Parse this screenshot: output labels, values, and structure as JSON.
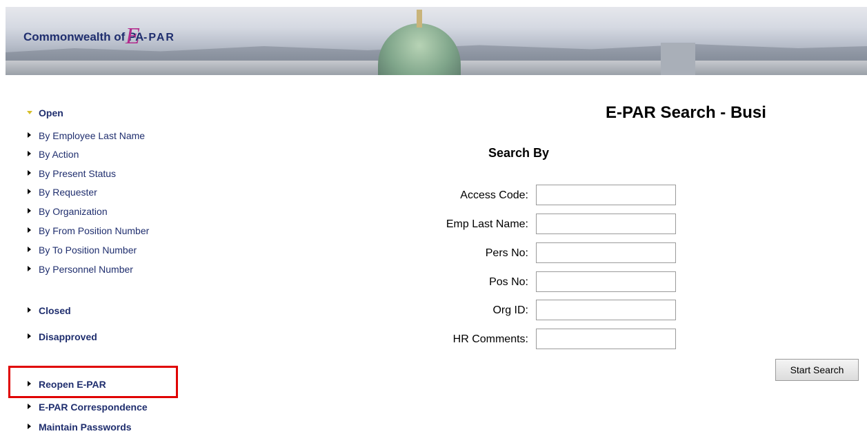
{
  "header": {
    "logo_text": "Commonwealth of PA",
    "logo_e": "E",
    "logo_suffix": "-PAR"
  },
  "sidebar": {
    "open_label": "Open",
    "sub_items": [
      "By Employee Last Name",
      "By Action",
      "By Present Status",
      "By Requester",
      "By Organization",
      "By From Position Number",
      "By To Position Number",
      "By Personnel Number"
    ],
    "closed_label": "Closed",
    "disapproved_label": "Disapproved",
    "reopen_label": "Reopen E-PAR",
    "correspondence_label": "E-PAR Correspondence",
    "passwords_label": "Maintain Passwords"
  },
  "main": {
    "page_title": "E-PAR Search - Busi",
    "section_heading": "Search By",
    "fields": [
      {
        "label": "Access Code:",
        "value": ""
      },
      {
        "label": "Emp Last Name:",
        "value": ""
      },
      {
        "label": "Pers No:",
        "value": ""
      },
      {
        "label": "Pos No:",
        "value": ""
      },
      {
        "label": "Org ID:",
        "value": ""
      },
      {
        "label": "HR Comments:",
        "value": ""
      }
    ],
    "start_search_label": "Start Search"
  },
  "colors": {
    "nav_text": "#1f2e6e",
    "highlight_border": "#e00000",
    "open_arrow": "#d6bf2a"
  }
}
